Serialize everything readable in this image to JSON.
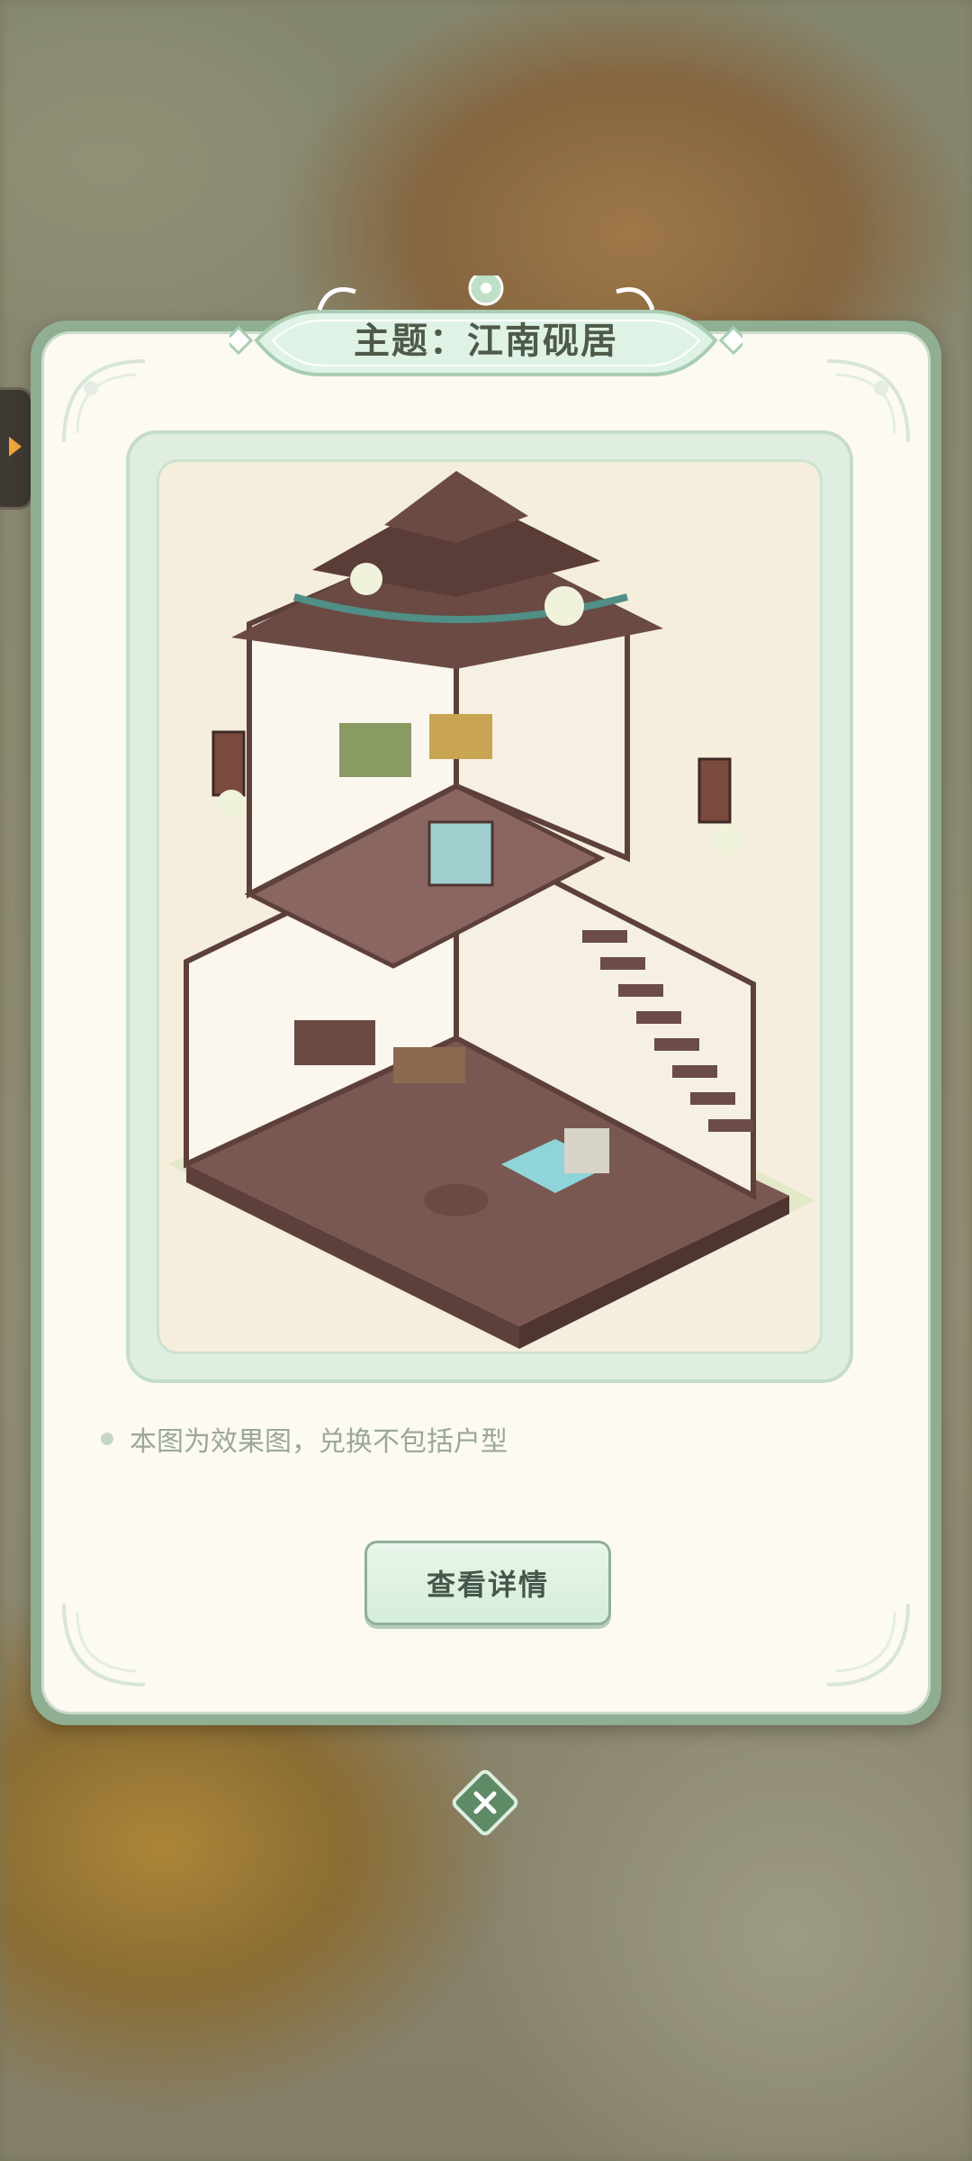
{
  "theme_title": "主题：江南砚居",
  "note_text": "本图为效果图，兑换不包括户型",
  "detail_button_label": "查看详情",
  "close_icon": "close-icon",
  "side_tab_icon": "chevron-right-icon",
  "colors": {
    "panel_border": "#8fae92",
    "panel_fill": "#fdfaf3",
    "accent_green": "#d6eedb",
    "title_text": "#4f5a4a",
    "side_arrow": "#f2a33a"
  }
}
